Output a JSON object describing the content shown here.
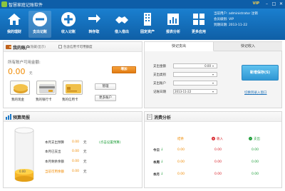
{
  "app": {
    "title": "智慧家庭记账软件",
    "vip": "VIP"
  },
  "toolbar": {
    "items": [
      {
        "label": "我的理财"
      },
      {
        "label": "支出记账"
      },
      {
        "label": "收入记账"
      },
      {
        "label": "转存取"
      },
      {
        "label": "借入借出"
      },
      {
        "label": "固定资产"
      },
      {
        "label": "报表分析"
      },
      {
        "label": "更多应用"
      }
    ]
  },
  "user": {
    "line1": "当前用户: administrator 注销",
    "line2": "会员级别: VIP",
    "line3": "到期日期: 2013-11-22"
  },
  "account": {
    "title": "我的账户",
    "subtitle": "(隐藏/显示)",
    "checkbox_label": "包含信用卡可用额度",
    "balance_label": "所有账户可用金额:",
    "balance_value": "0.00",
    "balance_unit": "元",
    "add_button": "增加",
    "cash_label": "我的现金",
    "bank_label": "我的银行卡",
    "credit_label": "我的信用卡",
    "manage_button": "管理",
    "more_button": "更多账户"
  },
  "record": {
    "tab_expense": "快记支出",
    "tab_income": "快记收入",
    "amount_label": "支出金额",
    "amount_value": "0.00",
    "category_label": "支出类别",
    "account_label": "支出账户",
    "date_label": "记账日期",
    "date_value": "2013-11-22",
    "save_button": "新增保存(S)",
    "detail_link": "切换到录入窗口"
  },
  "budget": {
    "title": "预算简报",
    "rows": [
      {
        "label": "本月支出预算",
        "value": "0.00",
        "unit": "元"
      },
      {
        "label": "本月已支出",
        "value": "0.00",
        "unit": "元"
      },
      {
        "label": "本月剩余余额",
        "value": "0.00",
        "unit": "元"
      },
      {
        "label": "当前可用余额",
        "value": "0.00",
        "unit": "元"
      }
    ],
    "link": "(点击设置预算)",
    "gauge_value": "0.00"
  },
  "analysis": {
    "title": "消费分析",
    "col_balance": "结余",
    "col_income": "收入",
    "col_expense": "支出",
    "rows": [
      {
        "label": "今日",
        "balance": "0.00",
        "income": "0.00",
        "expense": "0.00"
      },
      {
        "label": "本周",
        "balance": "0.00",
        "income": "0.00",
        "expense": "0.00"
      },
      {
        "label": "本月",
        "balance": "0.00",
        "income": "0.00",
        "expense": "0.00"
      }
    ]
  },
  "colors": {
    "header_blue": "#0e5ea8",
    "orange": "#f0901e",
    "money_orange": "#f08a00",
    "green": "#1f9e3a",
    "red": "#d8232a"
  }
}
